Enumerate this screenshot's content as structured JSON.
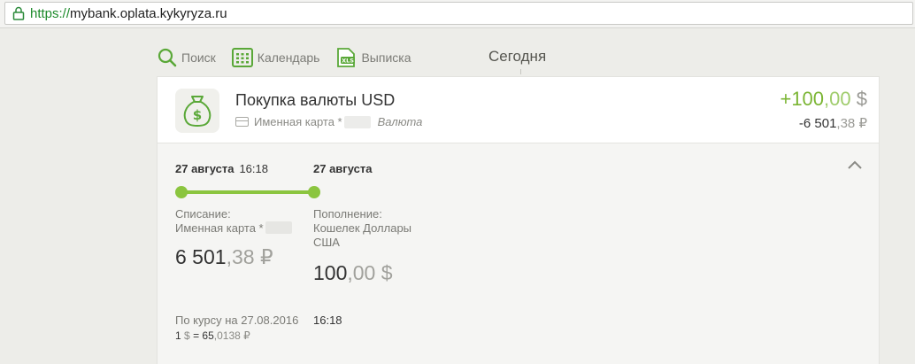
{
  "browser": {
    "url_scheme": "https://",
    "url_rest": "mybank.oplata.kykyryza.ru"
  },
  "toolbar": {
    "search_label": "Поиск",
    "calendar_label": "Календарь",
    "statement_label": "Выписка",
    "statement_icon_text": "XLS",
    "today_label": "Сегодня"
  },
  "transaction": {
    "title": "Покупка валюты USD",
    "card_label": "Именная карта *",
    "category": "Валюта",
    "amount_main": {
      "int": "+100",
      "frac": ",00",
      "currency": "$"
    },
    "amount_sub": {
      "int": "-6 501",
      "frac": ",38",
      "currency": "₽"
    }
  },
  "detail": {
    "debit": {
      "date": "27 августа",
      "time": "16:18",
      "label": "Списание:",
      "account": "Именная карта *",
      "amount": {
        "int": "6 501",
        "frac": ",38",
        "currency": "₽"
      }
    },
    "credit": {
      "date": "27 августа",
      "label": "Пополнение:",
      "account_line1": "Кошелек Доллары",
      "account_line2": "США",
      "amount": {
        "int": "100",
        "frac": ",00",
        "currency": "$"
      }
    },
    "rate": {
      "label": "По курсу на 27.08.2016",
      "time": "16:18",
      "lhs": "1",
      "lhs_currency": "$",
      "equals": "=",
      "value_int": "65",
      "value_frac": ",0138",
      "value_currency": "₽"
    }
  },
  "colors": {
    "accent_green": "#8bc53f",
    "amount_green": "#7bb534",
    "icon_green": "#5aa838"
  }
}
